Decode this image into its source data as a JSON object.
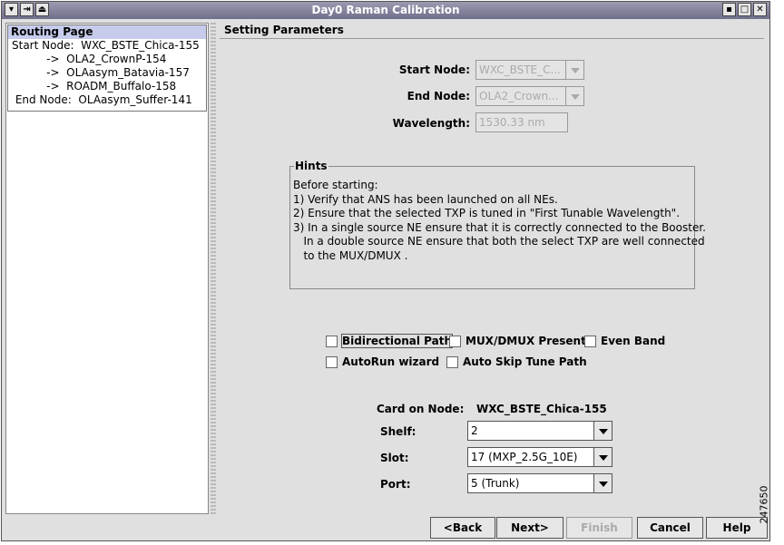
{
  "window": {
    "title": "Day0 Raman Calibration",
    "left_controls": [
      "menu-icon",
      "pin-icon",
      "roll-up-icon"
    ],
    "right_controls": [
      "minimize-icon",
      "maximize-icon",
      "close-icon"
    ]
  },
  "routing": {
    "header": "Routing Page",
    "lines": [
      "Start Node:  WXC_BSTE_Chica-155",
      "          ->  OLA2_CrownP-154",
      "          ->  OLAasym_Batavia-157",
      "          ->  ROADM_Buffalo-158",
      " End Node:  OLAasym_Suffer-141"
    ]
  },
  "params": {
    "section_title": "Setting Parameters",
    "start_node_label": "Start Node:",
    "start_node_value": "WXC_BSTE_C...",
    "end_node_label": "End Node:",
    "end_node_value": "OLA2_Crown...",
    "wavelength_label": "Wavelength:",
    "wavelength_value": "1530.33 nm"
  },
  "hints": {
    "legend": "Hints",
    "lines": [
      "Before starting:",
      "1) Verify that ANS has been launched on all NEs.",
      "2) Ensure that the selected TXP is tuned in \"First Tunable Wavelength\".",
      "3) In a single source NE ensure that it is correctly connected to the Booster.",
      "   In a double source NE ensure that both the select TXP are well connected",
      "   to the MUX/DMUX ."
    ]
  },
  "options": {
    "bidirectional": "Bidirectional Path",
    "mux_dmux": "MUX/DMUX Present",
    "even_band": "Even Band",
    "autorun": "AutoRun wizard",
    "auto_skip": "Auto Skip Tune Path"
  },
  "card": {
    "label": "Card on Node:",
    "node": "WXC_BSTE_Chica-155",
    "shelf_label": "Shelf:",
    "shelf_value": "2",
    "slot_label": "Slot:",
    "slot_value": "17 (MXP_2.5G_10E)",
    "port_label": "Port:",
    "port_value": "5 (Trunk)"
  },
  "buttons": {
    "back": "<Back",
    "next": "Next>",
    "finish": "Finish",
    "cancel": "Cancel",
    "help": "Help"
  },
  "figure_number": "247650"
}
